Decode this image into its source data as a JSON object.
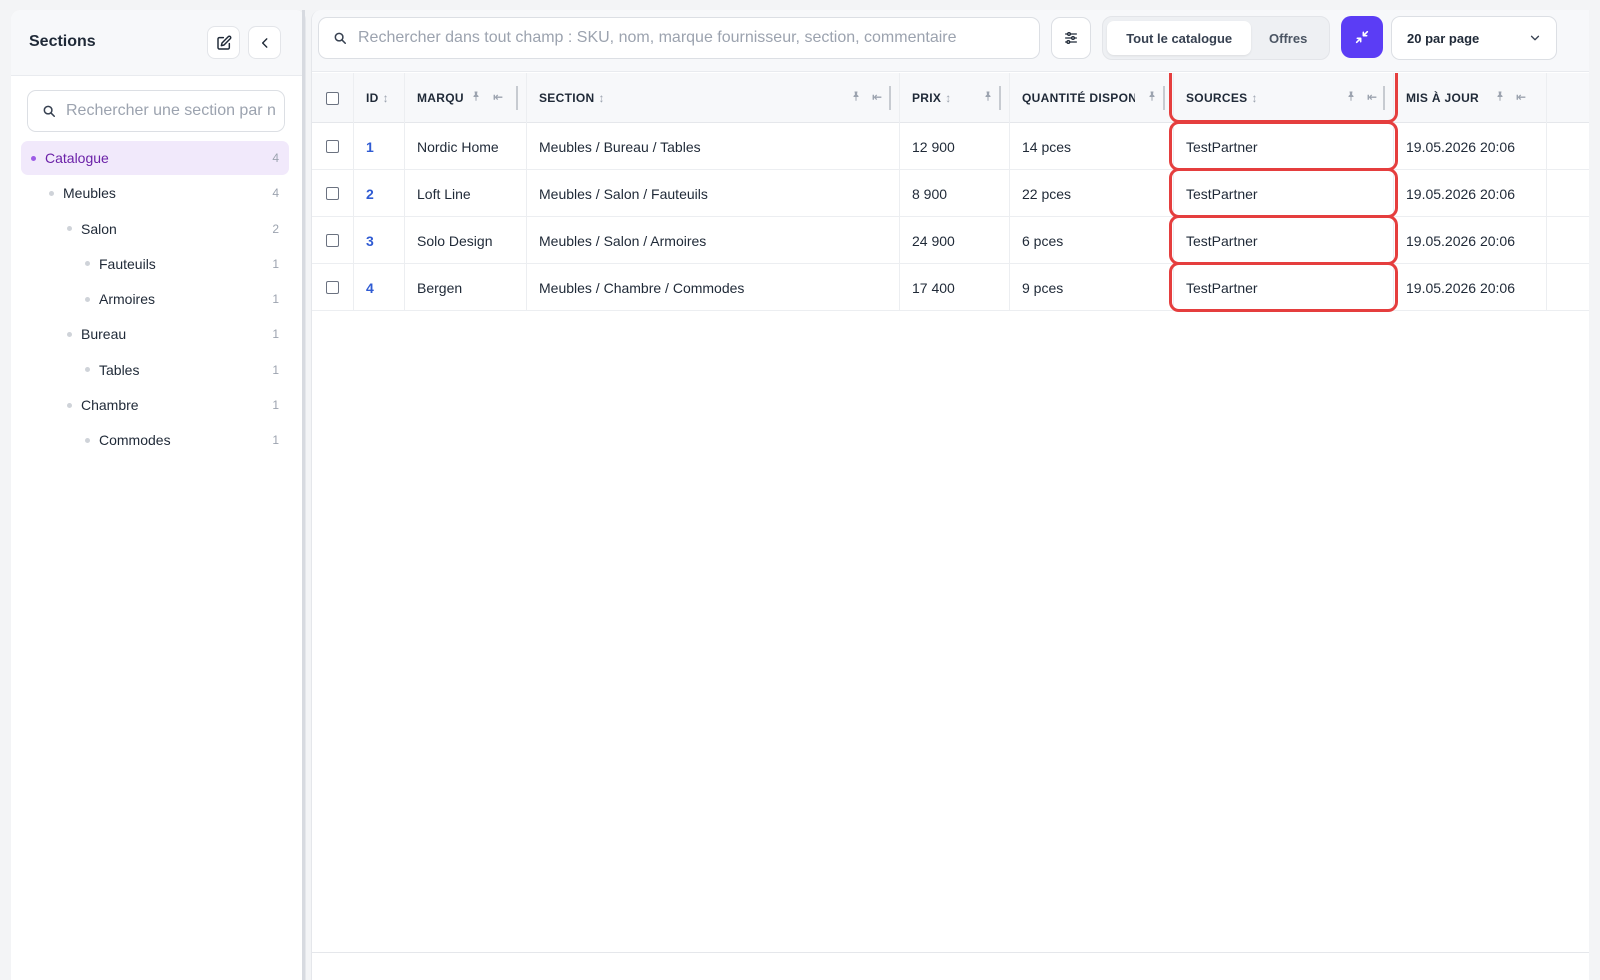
{
  "sidebar": {
    "title": "Sections",
    "search_placeholder": "Rechercher une section par nom",
    "tree": [
      {
        "label": "Catalogue",
        "count": "4",
        "level": 0,
        "active": true
      },
      {
        "label": "Meubles",
        "count": "4",
        "level": 1,
        "active": false
      },
      {
        "label": "Salon",
        "count": "2",
        "level": 2,
        "active": false
      },
      {
        "label": "Fauteuils",
        "count": "1",
        "level": 3,
        "active": false
      },
      {
        "label": "Armoires",
        "count": "1",
        "level": 3,
        "active": false
      },
      {
        "label": "Bureau",
        "count": "1",
        "level": 2,
        "active": false
      },
      {
        "label": "Tables",
        "count": "1",
        "level": 3,
        "active": false
      },
      {
        "label": "Chambre",
        "count": "1",
        "level": 2,
        "active": false
      },
      {
        "label": "Commodes",
        "count": "1",
        "level": 3,
        "active": false
      }
    ]
  },
  "toolbar": {
    "search_placeholder": "Rechercher dans tout champ : SKU, nom, marque fournisseur, section, commentaire",
    "tabs": [
      {
        "label": "Tout le catalogue",
        "active": true
      },
      {
        "label": "Offres",
        "active": false
      }
    ],
    "per_page": "20 par page"
  },
  "table": {
    "columns": [
      "ID",
      "MARQU",
      "SECTION",
      "PRIX",
      "QUANTITÉ DISPON",
      "SOURCES",
      "MIS À JOUR"
    ],
    "rows": [
      {
        "id": "1",
        "brand": "Nordic Home",
        "section": "Meubles / Bureau / Tables",
        "price": "12 900",
        "qty": "14 pces",
        "source": "TestPartner",
        "updated": "19.05.2026 20:06"
      },
      {
        "id": "2",
        "brand": "Loft Line",
        "section": "Meubles / Salon / Fauteuils",
        "price": "8 900",
        "qty": "22 pces",
        "source": "TestPartner",
        "updated": "19.05.2026 20:06"
      },
      {
        "id": "3",
        "brand": "Solo Design",
        "section": "Meubles / Salon / Armoires",
        "price": "24 900",
        "qty": "6 pces",
        "source": "TestPartner",
        "updated": "19.05.2026 20:06"
      },
      {
        "id": "4",
        "brand": "Bergen",
        "section": "Meubles / Chambre / Commodes",
        "price": "17 400",
        "qty": "9 pces",
        "source": "TestPartner",
        "updated": "19.05.2026 20:06"
      }
    ]
  },
  "colors": {
    "accent": "#5b3df5",
    "active_item_bg": "#f1e9fb",
    "active_item_text": "#6b21a8",
    "id_link": "#2f5bd3",
    "highlight": "#e53e3e"
  }
}
